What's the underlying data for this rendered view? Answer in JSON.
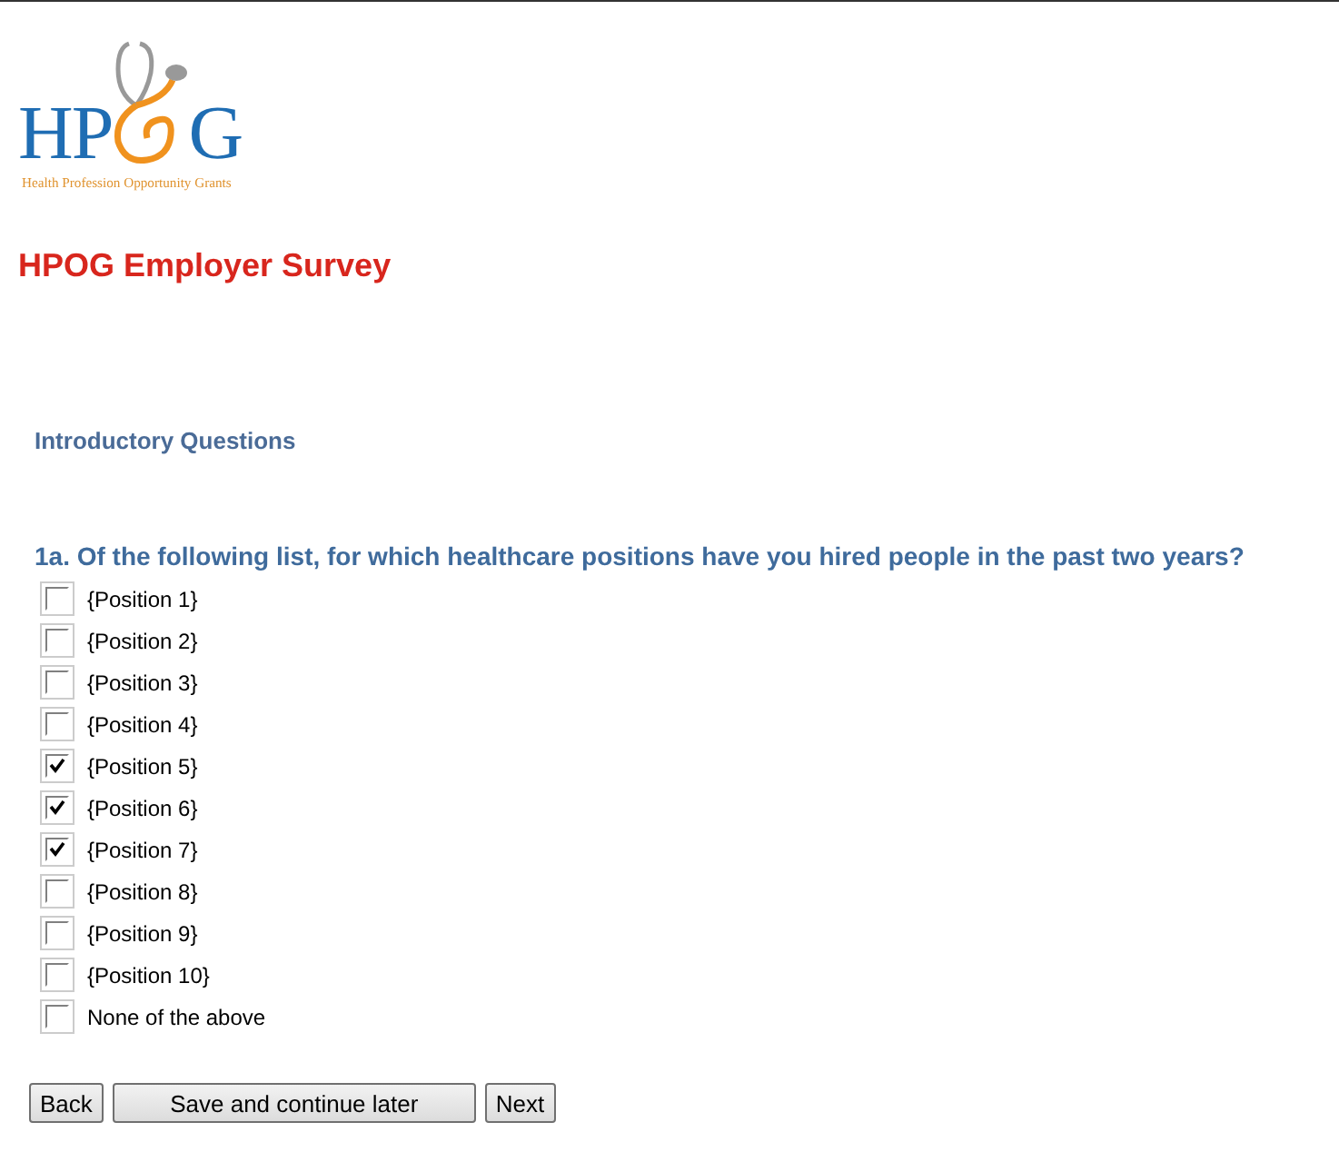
{
  "logo": {
    "lead": "HP",
    "tail": "G",
    "tagline": "Health Profession Opportunity Grants"
  },
  "title": "HPOG Employer Survey",
  "section": "Introductory Questions",
  "question": "1a. Of the following list, for which healthcare positions have you hired people in the past two years?",
  "options": [
    {
      "label": "{Position 1}",
      "checked": false
    },
    {
      "label": "{Position 2}",
      "checked": false
    },
    {
      "label": "{Position 3}",
      "checked": false
    },
    {
      "label": "{Position 4}",
      "checked": false
    },
    {
      "label": "{Position 5}",
      "checked": true
    },
    {
      "label": "{Position 6}",
      "checked": true
    },
    {
      "label": "{Position 7}",
      "checked": true
    },
    {
      "label": "{Position 8}",
      "checked": false
    },
    {
      "label": "{Position 9}",
      "checked": false
    },
    {
      "label": "{Position 10}",
      "checked": false
    },
    {
      "label": "None of the above",
      "checked": false
    }
  ],
  "buttons": [
    "Back",
    "Save and continue later",
    "Next"
  ]
}
